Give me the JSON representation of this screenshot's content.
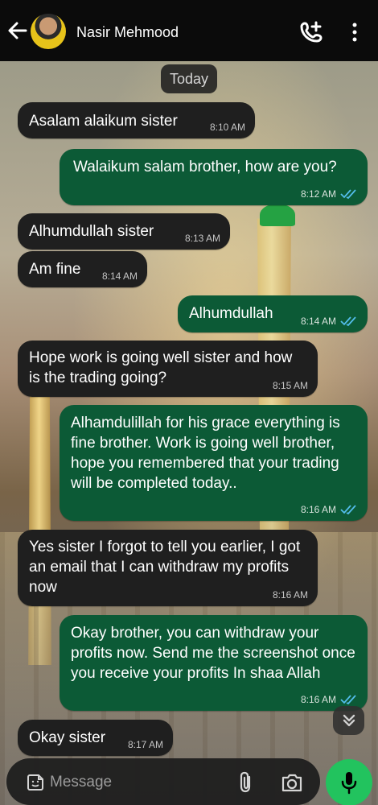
{
  "header": {
    "contact_name": "Nasir Mehmood",
    "icons": [
      "back-arrow-icon",
      "add-call-icon",
      "more-options-icon"
    ]
  },
  "chat": {
    "date_label": "Today",
    "messages": [
      {
        "direction": "incoming",
        "text": "Asalam alaikum sister",
        "time": "8:10 AM"
      },
      {
        "direction": "outgoing",
        "text": "Walaikum salam brother, how  are you?",
        "time": "8:12 AM",
        "status": "read"
      },
      {
        "direction": "incoming",
        "text": "Alhumdullah sister",
        "time": "8:13 AM"
      },
      {
        "direction": "incoming",
        "text": "Am fine",
        "time": "8:14 AM"
      },
      {
        "direction": "outgoing",
        "text": "Alhumdullah",
        "time": "8:14 AM",
        "status": "read"
      },
      {
        "direction": "incoming",
        "text": "Hope work is going well sister and how is the trading going?",
        "time": "8:15 AM"
      },
      {
        "direction": "outgoing",
        "text": "Alhamdulillah for his grace everything is fine brother. Work is going well brother, hope you remembered that your trading will be completed today..",
        "time": "8:16 AM",
        "status": "read"
      },
      {
        "direction": "incoming",
        "text": "Yes sister I forgot to tell you earlier, I got an email that I can withdraw my profits now",
        "time": "8:16 AM"
      },
      {
        "direction": "outgoing",
        "text": "Okay brother, you can withdraw your profits now. Send me the screenshot once you receive your profits In shaa Allah",
        "time": "8:16 AM",
        "status": "read"
      },
      {
        "direction": "incoming",
        "text": "Okay sister",
        "time": "8:17 AM"
      }
    ]
  },
  "composer": {
    "placeholder": "Message",
    "icons": [
      "emoji-sticker-icon",
      "paperclip-icon",
      "camera-icon",
      "microphone-icon"
    ]
  },
  "colors": {
    "incoming_bubble": "#1f1f1f",
    "outgoing_bubble": "#0c5a36",
    "read_ticks": "#53bdeb",
    "mic_button": "#22c35e"
  }
}
